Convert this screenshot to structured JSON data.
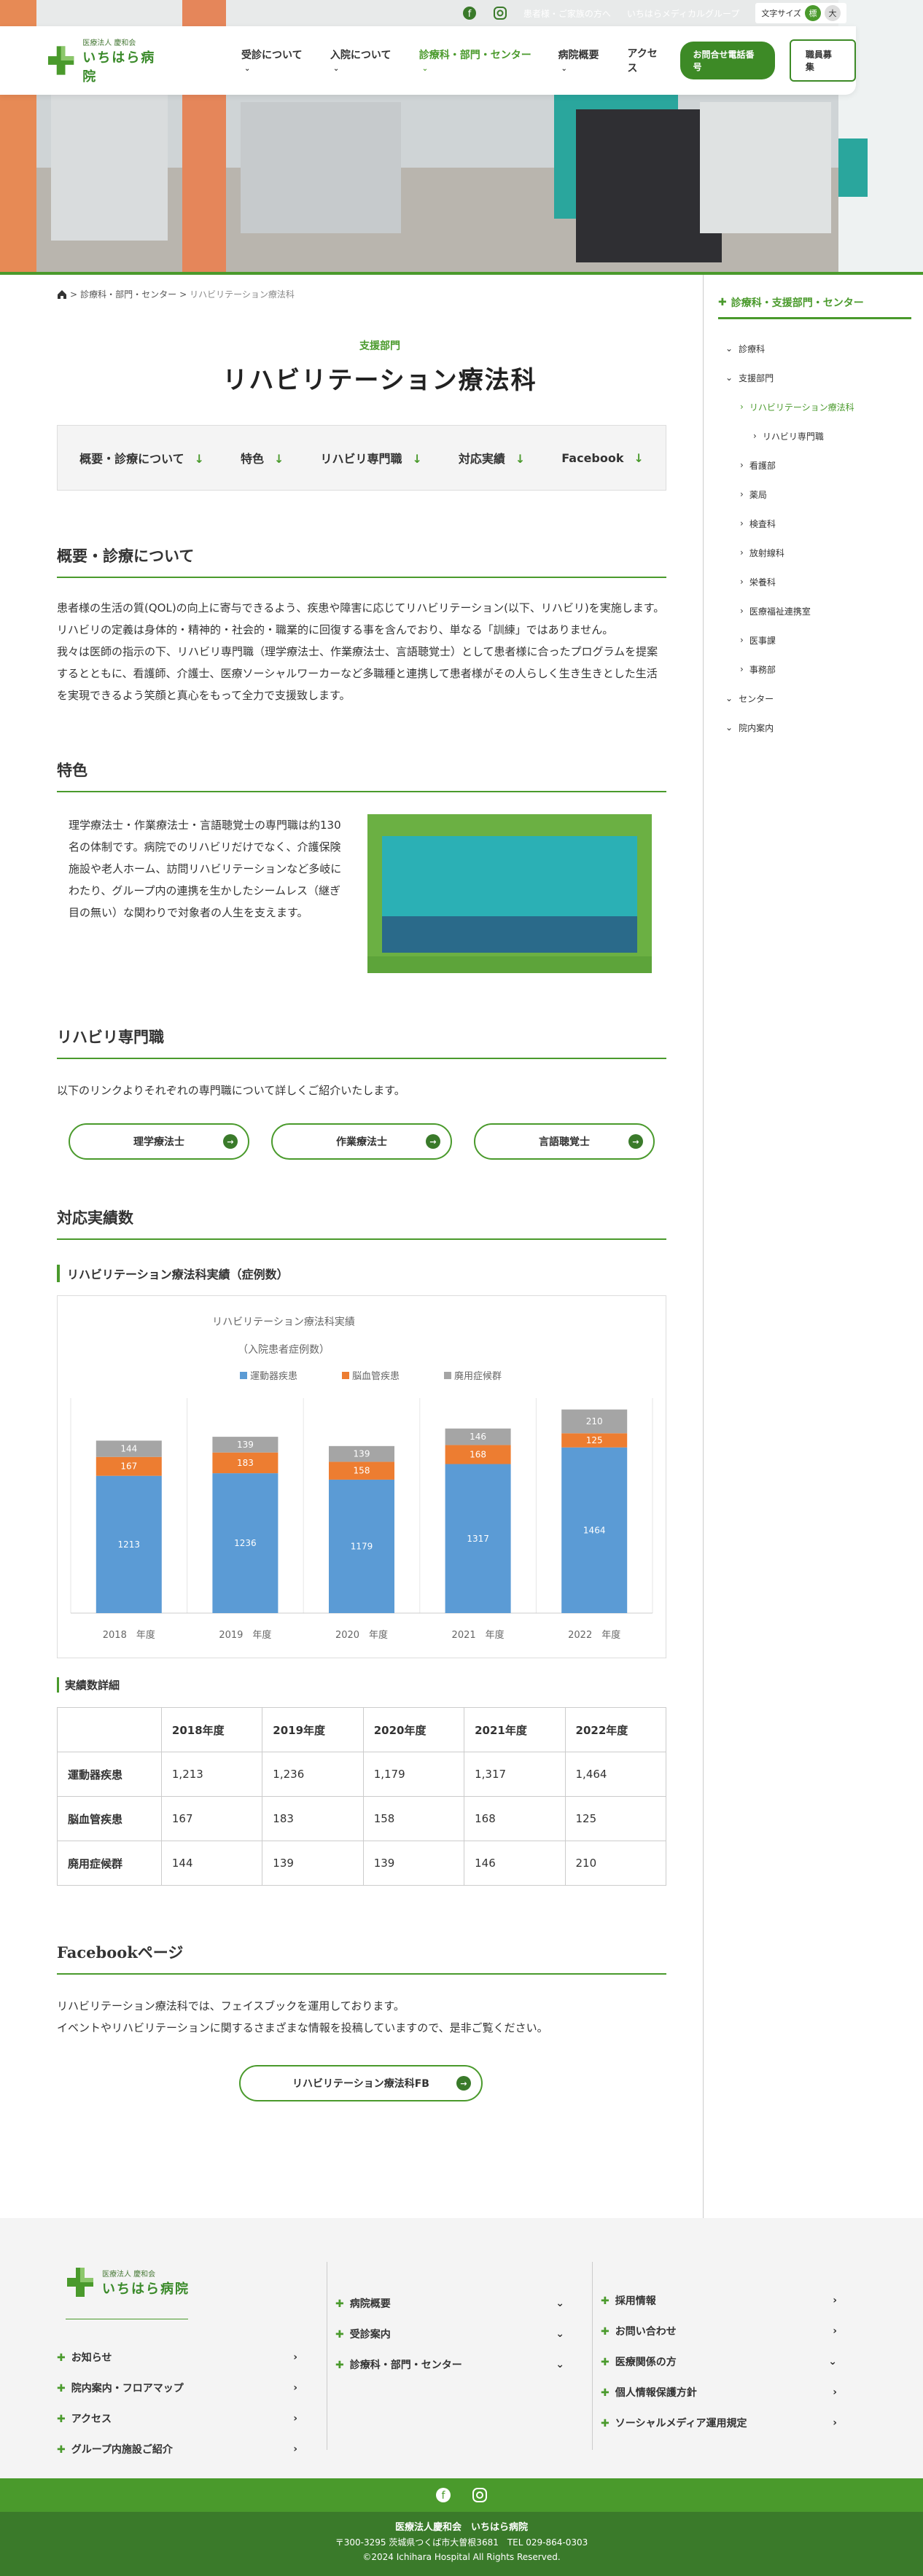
{
  "topbar": {
    "link_recruit": "患者様・ご家族の方へ",
    "link_group": "いちはらメディカルグループ",
    "font_size_label": "文字サイズ",
    "font_size_normal": "標",
    "font_size_large": "大"
  },
  "header": {
    "logo_small": "医療法人 慶和会",
    "logo_name": "いちはら病院",
    "nav": [
      "受診について",
      "入院について",
      "診療科・部門・センター",
      "病院概要",
      "アクセス"
    ],
    "tel_button": "お問合せ電話番号",
    "recruit_button": "職員募集"
  },
  "breadcrumb": {
    "items": [
      "診療科・部門・センター",
      "リハビリテーション療法科"
    ]
  },
  "page": {
    "section": "支援部門",
    "title": "リハビリテーション療法科",
    "anchors": [
      "概要・診療について",
      "特色",
      "リハビリ専門職",
      "対応実績",
      "Facebook"
    ]
  },
  "overview": {
    "heading": "概要・診療について",
    "body": [
      "患者様の生活の質(QOL)の向上に寄与できるよう、疾患や障害に応じてリハビリテーション(以下、リハビリ)を実施します。リハビリの定義は身体的・精神的・社会的・職業的に回復する事を含んでおり、単なる「訓練」ではありません。",
      "我々は医師の指示の下、リハビリ専門職（理学療法士、作業療法士、言語聴覚士）として患者様に合ったプログラムを提案するとともに、看護師、介護士、医療ソーシャルワーカーなど多職種と連携して患者様がその人らしく生き生きとした生活を実現できるよう笑顔と真心をもって全力で支援致します。"
    ]
  },
  "feature": {
    "heading": "特色",
    "body": "理学療法士・作業療法士・言語聴覚士の専門職は約130名の体制です。病院でのリハビリだけでなく、介護保険施設や老人ホーム、訪問リハビリテーションなど多岐にわたり、グループ内の連携を生かしたシームレス（継ぎ目の無い）な関わりで対象者の人生を支えます。"
  },
  "specialists": {
    "heading": "リハビリ専門職",
    "intro": "以下のリンクよりそれぞれの専門職について詳しくご紹介いたします。",
    "buttons": [
      "理学療法士",
      "作業療法士",
      "言語聴覚士"
    ]
  },
  "results": {
    "heading": "対応実績数",
    "sub_heading": "リハビリテーション療法科実績（症例数）",
    "detail_heading": "実績数詳細",
    "table": {
      "headers": [
        "",
        "2018年度",
        "2019年度",
        "2020年度",
        "2021年度",
        "2022年度"
      ],
      "rows": [
        [
          "運動器疾患",
          "1,213",
          "1,236",
          "1,179",
          "1,317",
          "1,464"
        ],
        [
          "脳血管疾患",
          "167",
          "183",
          "158",
          "168",
          "125"
        ],
        [
          "廃用症候群",
          "144",
          "139",
          "139",
          "146",
          "210"
        ]
      ]
    }
  },
  "chart_data": {
    "type": "bar",
    "stacked": true,
    "title": "リハビリテーション療法科実績",
    "subtitle": "（入院患者症例数）",
    "categories": [
      "2018　年度",
      "2019　年度",
      "2020　年度",
      "2021　年度",
      "2022　年度"
    ],
    "series": [
      {
        "name": "運動器疾患",
        "color": "#5b9bd5",
        "values": [
          1213,
          1236,
          1179,
          1317,
          1464
        ]
      },
      {
        "name": "脳血管疾患",
        "color": "#ed7d31",
        "values": [
          167,
          183,
          158,
          168,
          125
        ]
      },
      {
        "name": "廃用症候群",
        "color": "#a5a5a5",
        "values": [
          144,
          139,
          139,
          146,
          210
        ]
      }
    ],
    "ylim": [
      0,
      1900
    ],
    "legend": "top",
    "grid": false
  },
  "facebook": {
    "heading": "Facebookページ",
    "body": [
      "リハビリテーション療法科では、フェイスブックを運用しております。",
      "イベントやリハビリテーションに関するさまざまな情報を投稿していますので、是非ご覧ください。"
    ],
    "button": "リハビリテーション療法科FB"
  },
  "sidebar": {
    "title": "診療科・支援部門・センター",
    "items": [
      {
        "label": "診療科",
        "level": 1,
        "arrow": "⌄"
      },
      {
        "label": "支援部門",
        "level": 1,
        "arrow": "⌄"
      },
      {
        "label": "リハビリテーション療法科",
        "level": 2,
        "arrow": "›",
        "active": true
      },
      {
        "label": "リハビリ専門職",
        "level": 3,
        "arrow": "›"
      },
      {
        "label": "看護部",
        "level": 2,
        "arrow": "›"
      },
      {
        "label": "薬局",
        "level": 2,
        "arrow": "›"
      },
      {
        "label": "検査科",
        "level": 2,
        "arrow": "›"
      },
      {
        "label": "放射線科",
        "level": 2,
        "arrow": "›"
      },
      {
        "label": "栄養科",
        "level": 2,
        "arrow": "›"
      },
      {
        "label": "医療福祉連携室",
        "level": 2,
        "arrow": "›"
      },
      {
        "label": "医事課",
        "level": 2,
        "arrow": "›"
      },
      {
        "label": "事務部",
        "level": 2,
        "arrow": "›"
      },
      {
        "label": "センター",
        "level": 1,
        "arrow": "⌄"
      },
      {
        "label": "院内案内",
        "level": 1,
        "arrow": "⌄"
      }
    ]
  },
  "footer": {
    "col1": [
      "お知らせ",
      "院内案内・フロアマップ",
      "アクセス",
      "グループ内施設ご紹介"
    ],
    "col2": [
      "病院概要",
      "受診案内",
      "診療科・部門・センター"
    ],
    "col3": [
      "採用情報",
      "お問い合わせ",
      "医療関係の方",
      "個人情報保護方針",
      "ソーシャルメディア運用規定"
    ],
    "org": "医療法人慶和会　いちはら病院",
    "address": "〒300-3295 茨城県つくば市大曽根3681　TEL 029-864-0303",
    "copyright": "©2024 Ichihara Hospital All Rights Reserved."
  },
  "colors": {
    "brand": "#4a9a2c",
    "brand_dark": "#3a7a2a"
  }
}
